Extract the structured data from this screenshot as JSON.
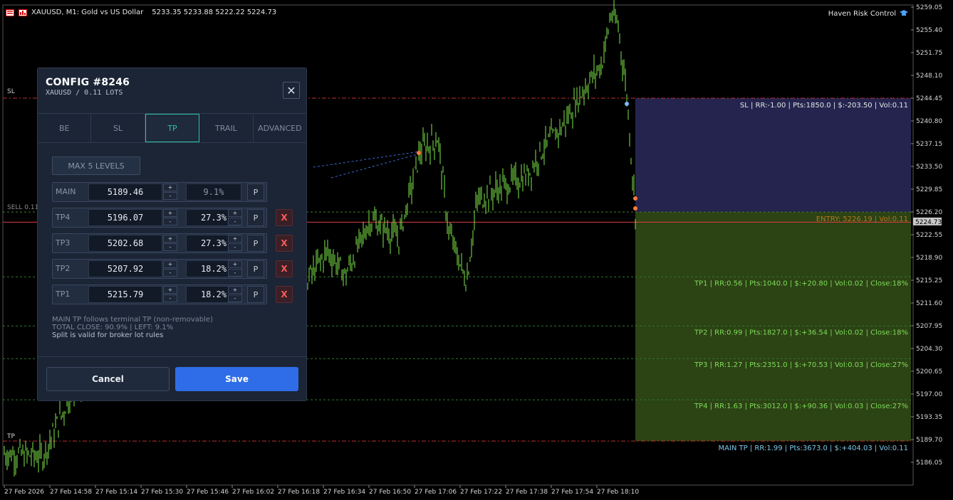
{
  "header": {
    "symbol_text": "XAUUSD, M1:  Gold vs US Dollar",
    "ohlc": "5233.35 5233.88 5222.22 5224.73"
  },
  "brand": {
    "label": "Haven Risk Control"
  },
  "chart_labels": {
    "sl": "SL",
    "sell": "SELL 0.11",
    "tp": "TP"
  },
  "chart_data": {
    "type": "line",
    "y_ticks": [
      "5259.05",
      "5255.40",
      "5251.75",
      "5248.10",
      "5244.45",
      "5240.80",
      "5237.15",
      "5233.50",
      "5229.85",
      "5226.20",
      "5222.55",
      "5218.90",
      "5215.25",
      "5211.60",
      "5207.95",
      "5204.30",
      "5200.65",
      "5197.00",
      "5193.35",
      "5189.70",
      "5186.05"
    ],
    "x_ticks": [
      "27 Feb 2026",
      "27 Feb 14:58",
      "27 Feb 15:14",
      "27 Feb 15:30",
      "27 Feb 15:46",
      "27 Feb 16:02",
      "27 Feb 16:18",
      "27 Feb 16:34",
      "27 Feb 16:50",
      "27 Feb 17:06",
      "27 Feb 17:22",
      "27 Feb 17:38",
      "27 Feb 17:54",
      "27 Feb 18:10"
    ],
    "current_price": "5224.73",
    "ylim": [
      5184.5,
      5259.05
    ]
  },
  "levels": {
    "sl": "SL | RR:-1.00 | Pts:1850.0 | $:-203.50 | Vol:0.11",
    "entry": "ENTRY: 5226.19 | Vol:0.11",
    "tp1": "TP1 | RR:0.56 | Pts:1040.0 | $:+20.80 | Vol:0.02 | Close:18%",
    "tp2": "TP2 | RR:0.99 | Pts:1827.0 | $:+36.54 | Vol:0.02 | Close:18%",
    "tp3": "TP3 | RR:1.27 | Pts:2351.0 | $:+70.53 | Vol:0.03 | Close:27%",
    "tp4": "TP4 | RR:1.63 | Pts:3012.0 | $:+90.36 | Vol:0.03 | Close:27%",
    "main": "MAIN TP | RR:1.99 | Pts:3673.0 | $:+404.03 | Vol:0.11"
  },
  "panel": {
    "title": "CONFIG #8246",
    "subtitle": "XAUUSD / 0.11 LOTS",
    "close": "✕",
    "tabs": [
      "BE",
      "SL",
      "TP",
      "TRAIL",
      "ADVANCED"
    ],
    "max_levels": "MAX 5 LEVELS",
    "plus": "+",
    "minus": "-",
    "p": "P",
    "x": "X",
    "rows": [
      {
        "name": "MAIN",
        "price": "5189.46",
        "pct": "9.1%"
      },
      {
        "name": "TP4",
        "price": "5196.07",
        "pct": "27.3%"
      },
      {
        "name": "TP3",
        "price": "5202.68",
        "pct": "27.3%"
      },
      {
        "name": "TP2",
        "price": "5207.92",
        "pct": "18.2%"
      },
      {
        "name": "TP1",
        "price": "5215.79",
        "pct": "18.2%"
      }
    ],
    "note1": "MAIN TP follows terminal TP (non-removable)",
    "note2": "TOTAL CLOSE: 90.9% | LEFT: 9.1%",
    "note3": "Split is valid for broker lot rules",
    "cancel": "Cancel",
    "save": "Save"
  },
  "colors": {
    "sl_zone": "#24244f",
    "tp_zone": "#2c4314",
    "candle": "#7ee84a",
    "entry_line": "#e04040"
  }
}
